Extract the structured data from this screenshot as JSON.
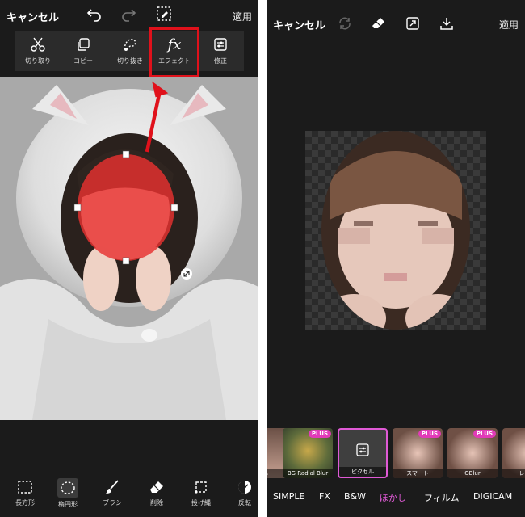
{
  "left": {
    "topbar": {
      "cancel": "キャンセル",
      "apply": "適用"
    },
    "tools": [
      {
        "label": "切り取り",
        "icon": "scissors-icon"
      },
      {
        "label": "コピー",
        "icon": "copy-icon"
      },
      {
        "label": "切り抜き",
        "icon": "cutout-icon"
      },
      {
        "label": "エフェクト",
        "icon": "fx-icon",
        "glyph": "fx"
      },
      {
        "label": "修正",
        "icon": "adjust-icon"
      }
    ],
    "bottom_tools": [
      {
        "label": "長方形",
        "icon": "rectangle-select-icon"
      },
      {
        "label": "楕円形",
        "icon": "ellipse-select-icon"
      },
      {
        "label": "ブラシ",
        "icon": "brush-icon"
      },
      {
        "label": "削除",
        "icon": "eraser-icon"
      },
      {
        "label": "投げ縄",
        "icon": "lasso-icon"
      },
      {
        "label": "反転",
        "icon": "invert-icon"
      }
    ],
    "highlight_color": "#e0111b",
    "selection_color": "#e8312f"
  },
  "right": {
    "topbar": {
      "cancel": "キャンセル",
      "apply": "適用"
    },
    "thumbnails": [
      {
        "label": "し",
        "plus": false
      },
      {
        "label": "BG Radial Blur",
        "plus": true,
        "plus_label": "PLUS"
      },
      {
        "label": "ピクセル",
        "plus": false,
        "selected": true
      },
      {
        "label": "スマート",
        "plus": true,
        "plus_label": "PLUS"
      },
      {
        "label": "GBlur",
        "plus": true,
        "plus_label": "PLUS"
      },
      {
        "label": "レンズ",
        "plus": false
      }
    ],
    "categories": [
      {
        "label": "SIMPLE"
      },
      {
        "label": "FX"
      },
      {
        "label": "B&W"
      },
      {
        "label": "ぼかし",
        "active": true
      },
      {
        "label": "フィルム"
      },
      {
        "label": "DIGICAM"
      }
    ],
    "accent_color": "#e05ad6"
  }
}
